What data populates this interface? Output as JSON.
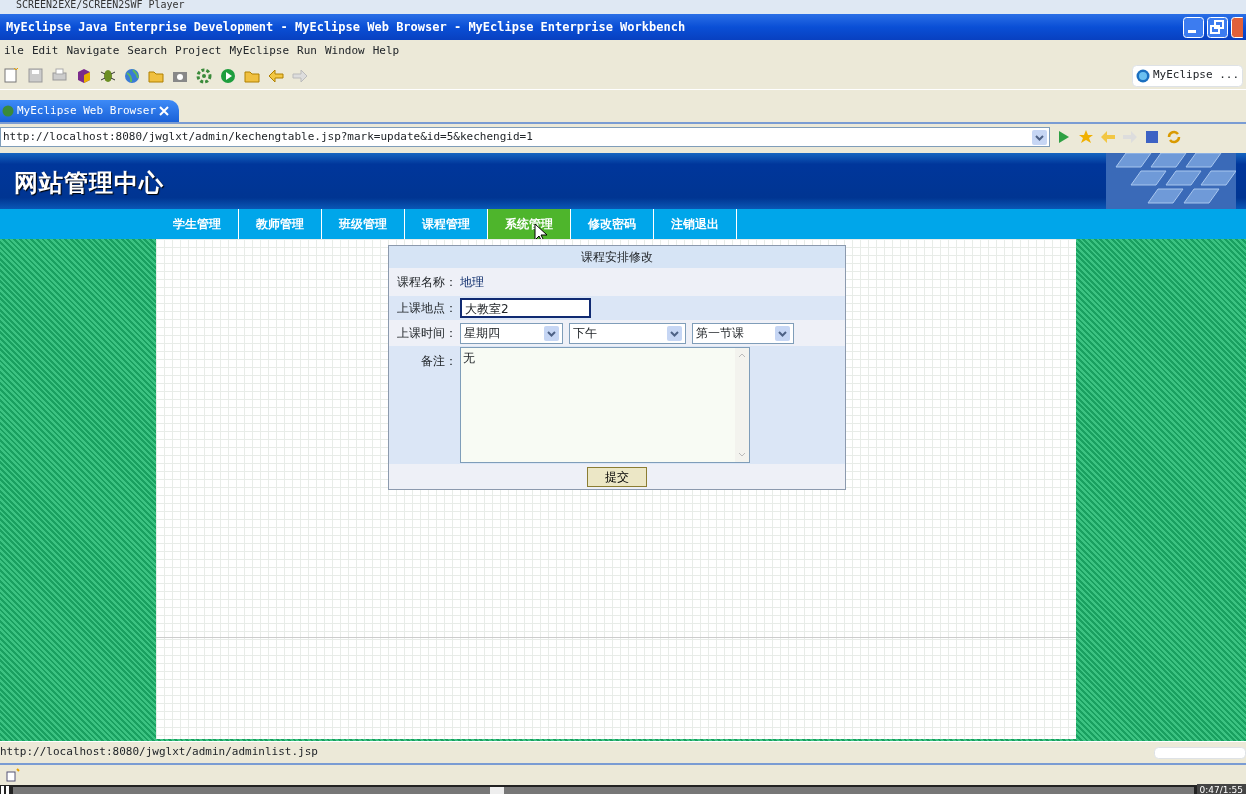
{
  "player": {
    "title": "SCREEN2EXE/SCREEN2SWF Player",
    "time": "0:47/1:55",
    "level": 0.41
  },
  "window": {
    "title": "MyEclipse Java Enterprise Development - MyEclipse Web Browser - MyEclipse Enterprise Workbench"
  },
  "menu": [
    "ile",
    "Edit",
    "Navigate",
    "Search",
    "Project",
    "MyEclipse",
    "Run",
    "Window",
    "Help"
  ],
  "perspective": "MyEclipse ...",
  "editor_tabs": [
    {
      "label": "MyEclipse Web Browser",
      "selected": true
    }
  ],
  "browser": {
    "url": "http://localhost:8080/jwglxt/admin/kechengtable.jsp?mark=update&id=5&kechengid=1",
    "status": "http://localhost:8080/jwglxt/admin/adminlist.jsp"
  },
  "site": {
    "title": "网站管理中心",
    "nav": [
      {
        "label": "学生管理",
        "selected": false
      },
      {
        "label": "教师管理",
        "selected": false
      },
      {
        "label": "班级管理",
        "selected": false
      },
      {
        "label": "课程管理",
        "selected": false
      },
      {
        "label": "系统管理",
        "selected": true
      },
      {
        "label": "修改密码",
        "selected": false
      },
      {
        "label": "注销退出",
        "selected": false
      }
    ],
    "form": {
      "title": "课程安排修改",
      "rows": [
        {
          "kind": "text",
          "label": "课程名称：",
          "value": "地理"
        },
        {
          "kind": "input",
          "label": "上课地点：",
          "value": "大教室2"
        },
        {
          "kind": "selects",
          "label": "上课时间：",
          "options": [
            "星期四",
            "下午",
            "第一节课"
          ]
        },
        {
          "kind": "textarea",
          "label": "备注：",
          "value": "无"
        }
      ],
      "submit": "提交"
    }
  }
}
